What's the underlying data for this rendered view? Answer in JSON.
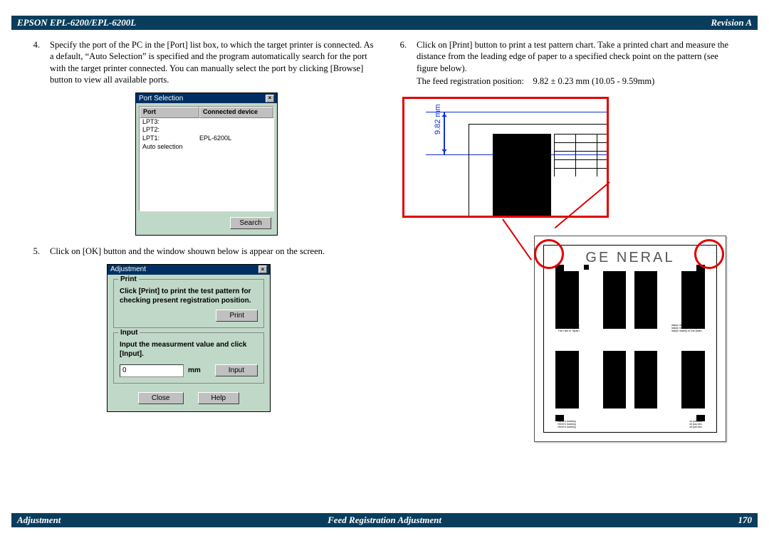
{
  "header": {
    "left": "EPSON EPL-6200/EPL-6200L",
    "right": "Revision A"
  },
  "footer": {
    "left": "Adjustment",
    "center": "Feed Registration Adjustment",
    "right": "170"
  },
  "steps": {
    "s4": {
      "num": "4.",
      "text": "Specify the port of the PC in the [Port] list box, to which the target printer is connected. As a default, “Auto Selection” is specified and the program automatically search for the port with the target printer connected. You can manually select the port by clicking [Browse] button to view all available ports."
    },
    "s5": {
      "num": "5.",
      "text": "Click on [OK] button and the window shouwn below is appear on the screen."
    },
    "s6": {
      "num": "6.",
      "text": "Click on [Print] button to print a test pattern chart. Take a printed chart and measure the distance from the leading edge of paper to a specified check point on the pattern (see figure below)."
    },
    "s6_spec": "The feed registration position:    9.82 ± 0.23 mm (10.05 - 9.59mm)"
  },
  "dialog1": {
    "title": "Port Selection",
    "col1": "Port",
    "col2": "Connected device",
    "rows": [
      {
        "port": "LPT3:",
        "dev": ""
      },
      {
        "port": "LPT2:",
        "dev": ""
      },
      {
        "port": "LPT1:",
        "dev": "EPL-6200L"
      },
      {
        "port": "Auto selection",
        "dev": ""
      }
    ],
    "search_btn": "Search"
  },
  "dialog2": {
    "title": "Adjustment",
    "print_legend": "Print",
    "print_text": "Click [Print] to print the test pattern for checking present registration position.",
    "print_btn": "Print",
    "input_legend": "Input",
    "input_text": "Input the measurment value and click [Input].",
    "input_value": "0",
    "unit": "mm",
    "input_btn": "Input",
    "close_btn": "Close",
    "help_btn": "Help"
  },
  "figure": {
    "measure": "9.82 mm",
    "general": "GE  NERAL"
  }
}
